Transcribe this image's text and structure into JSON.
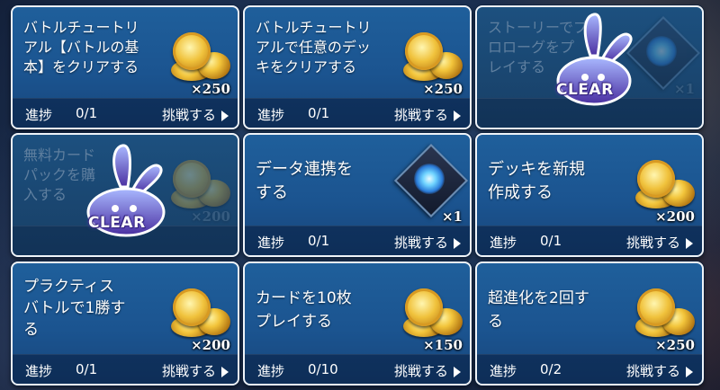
{
  "common": {
    "progress_label": "進捗",
    "challenge_label": "挑戦する",
    "clear_label": "CLEAR"
  },
  "missions": [
    {
      "title": "バトルチュートリ\nアル【バトルの基\n本】をクリアする",
      "reward": "coin",
      "qty": "×250",
      "progress": "0/1",
      "cleared": false
    },
    {
      "title": "バトルチュートリ\nアルで任意のデッ\nキをクリアする",
      "reward": "coin",
      "qty": "×250",
      "progress": "0/1",
      "cleared": false
    },
    {
      "title": "ストーリーでプ\nロローグをプ\nレイする",
      "reward": "gem",
      "qty": "×1",
      "progress": "",
      "cleared": true
    },
    {
      "title": "無料カード\nパックを購\n入する",
      "reward": "coin",
      "qty": "×200",
      "progress": "",
      "cleared": true
    },
    {
      "title": "データ連携を\nする",
      "reward": "gem",
      "qty": "×1",
      "progress": "0/1",
      "cleared": false
    },
    {
      "title": "デッキを新規\n作成する",
      "reward": "coin",
      "qty": "×200",
      "progress": "0/1",
      "cleared": false
    },
    {
      "title": "プラクティス\nバトルで1勝す\nる",
      "reward": "coin",
      "qty": "×200",
      "progress": "0/1",
      "cleared": false
    },
    {
      "title": "カードを10枚\nプレイする",
      "reward": "coin",
      "qty": "×150",
      "progress": "0/10",
      "cleared": false
    },
    {
      "title": "超進化を2回す\nる",
      "reward": "coin",
      "qty": "×250",
      "progress": "0/2",
      "cleared": false
    }
  ]
}
